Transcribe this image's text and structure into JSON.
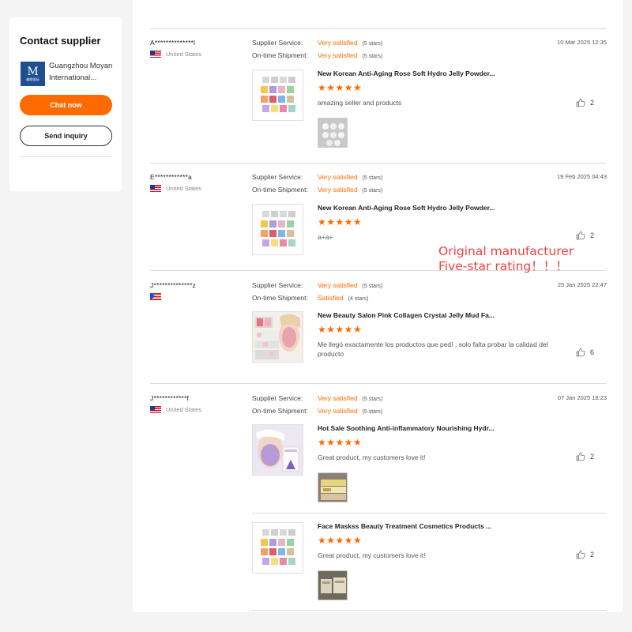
{
  "supplier": {
    "title": "Contact supplier",
    "company_line1": "Guangzhou Moyan",
    "company_line2": "International...",
    "logo_letter": "M",
    "logo_sub": "美颜国际",
    "chat_label": "Chat now",
    "inquiry_label": "Send inquiry",
    "accent_color": "#ff6a00"
  },
  "labels": {
    "service": "Supplier Service:",
    "shipment": "On-time Shipment:"
  },
  "overlay": {
    "line1": "Original manufacturer",
    "line2": "Five-star rating！！！",
    "color": "#f43f3f"
  },
  "reviews": [
    {
      "buyer": "A**************l",
      "country": "United States",
      "flag": "us-flag",
      "date": "10 Mar 2025 12:35",
      "service_value": "Very satisfied",
      "service_stars": "(5 stars)",
      "shipment_value": "Very satisfied",
      "shipment_stars": "(5 stars)",
      "items": [
        {
          "title": "New Korean Anti-Aging Rose Soft Hydro Jelly Powder...",
          "rating": 5,
          "stars": "★★★★★",
          "comment": "amazing seller and products",
          "likes": "2"
        }
      ]
    },
    {
      "buyer": "E************a",
      "country": "United States",
      "flag": "us-flag",
      "date": "19 Feb 2025 04:43",
      "service_value": "Very satisfied",
      "service_stars": "(5 stars)",
      "shipment_value": "Very satisfied",
      "shipment_stars": "(5 stars)",
      "items": [
        {
          "title": "New Korean Anti-Aging Rose Soft Hydro Jelly Powder...",
          "rating": 5,
          "stars": "★★★★★",
          "comment": "a+a+",
          "likes": "2"
        }
      ]
    },
    {
      "buyer": "J**************z",
      "country": "",
      "flag": "puerto-rico-flag",
      "date": "25 Jan 2025 22:47",
      "service_value": "Very satisfied",
      "service_stars": "(5 stars)",
      "shipment_value": "Satisfied",
      "shipment_stars": "(4 stars)",
      "items": [
        {
          "title": "New Beauty Salon Pink Collagen Crystal Jelly Mud Fa...",
          "rating": 5,
          "stars": "★★★★★",
          "comment": "Me llegó exactamente los productos que pedí , solo falta probar la calidad del producto",
          "likes": "6"
        }
      ]
    },
    {
      "buyer": "J************f",
      "country": "United States",
      "flag": "us-flag",
      "date": "07 Jan 2025 18:23",
      "service_value": "Very satisfied",
      "service_stars": "(5 stars)",
      "shipment_value": "Very satisfied",
      "shipment_stars": "(5 stars)",
      "items": [
        {
          "title": "Hot Sale Soothing Anti-inflammatory Nourishing Hydr...",
          "rating": 5,
          "stars": "★★★★★",
          "comment": "Great product, my customers love it!",
          "likes": "2"
        },
        {
          "title": "Face Maskss Beauty Treatment Cosmetics Products ...",
          "rating": 5,
          "stars": "★★★★★",
          "comment": "Great product, my customers love it!",
          "likes": "2"
        }
      ]
    }
  ]
}
